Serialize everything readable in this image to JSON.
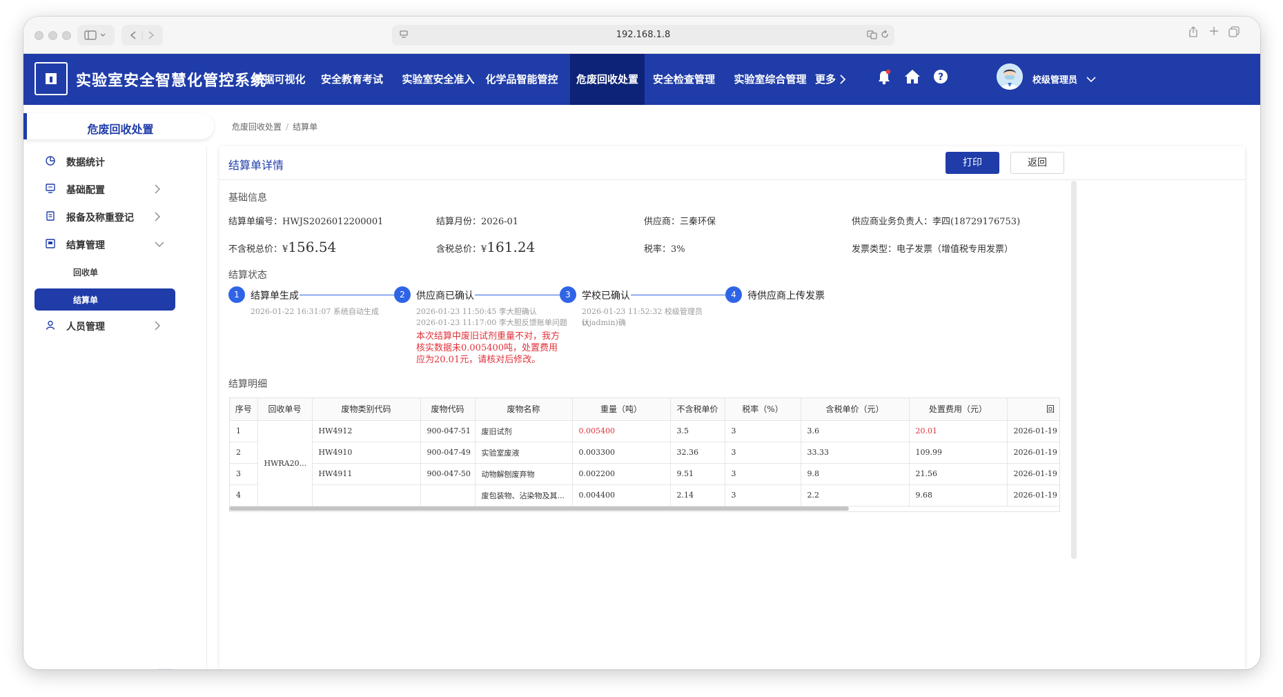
{
  "browser": {
    "url": "192.168.1.8"
  },
  "header": {
    "title": "实验室安全智慧化管控系统",
    "nav": [
      "数据可视化",
      "安全教育考试",
      "实验室安全准入",
      "化学品智能管控",
      "危废回收处置",
      "安全检查管理",
      "实验室综合管理",
      "更多"
    ],
    "user": "校级管理员"
  },
  "sidebar": {
    "title": "危废回收处置",
    "items": [
      {
        "label": "数据统计"
      },
      {
        "label": "基础配置"
      },
      {
        "label": "报备及称重登记"
      },
      {
        "label": "结算管理"
      },
      {
        "label": "回收单"
      },
      {
        "label": "结算单"
      },
      {
        "label": "人员管理"
      }
    ]
  },
  "breadcrumb": {
    "parent": "危废回收处置",
    "sep": "/",
    "current": "结算单"
  },
  "panel": {
    "title": "结算单详情",
    "print": "打印",
    "back": "返回"
  },
  "basic": {
    "section": "基础信息",
    "no_label": "结算单编号：",
    "no": "HWJS2026012200001",
    "month_label": "结算月份：",
    "month": "2026-01",
    "supplier_label": "供应商：",
    "supplier": "三秦环保",
    "contact_label": "供应商业务负责人：",
    "contact": "李四(18729176753)",
    "pretax_label": "不含税总价：",
    "currency": "¥",
    "pretax": "156.54",
    "tax_total_label": "含税总价：",
    "tax_total": "161.24",
    "rate_label": "税率：",
    "rate": "3%",
    "invoice_label": "发票类型：",
    "invoice": "电子发票（增值税专用发票）"
  },
  "status": {
    "section": "结算状态",
    "steps": [
      {
        "num": "1",
        "title": "结算单生成",
        "desc": [
          "2026-01-22 16:31:07 系统自动生成"
        ]
      },
      {
        "num": "2",
        "title": "供应商已确认",
        "desc": [
          "2026-01-23 11:50:45 李大胆确认",
          "2026-01-23 11:17:00 李大胆反馈账单问题"
        ],
        "note": "本次结算中废旧试剂重量不对，我方核实数据未0.005400吨，处置费用应为20.01元，请核对后修改。"
      },
      {
        "num": "3",
        "title": "学校已确认",
        "desc": [
          "2026-01-23 11:52:32 校级管理员(xjadmin)确",
          "认"
        ]
      },
      {
        "num": "4",
        "title": "待供应商上传发票",
        "desc": []
      }
    ]
  },
  "detail": {
    "section": "结算明细",
    "columns": [
      "序号",
      "回收单号",
      "废物类别代码",
      "废物代码",
      "废物名称",
      "重量（吨）",
      "不含税单价",
      "税率（%）",
      "含税单价（元）",
      "处置费用（元）",
      "回"
    ],
    "recycle_no": "HWRA20...",
    "rows": [
      {
        "idx": "1",
        "cat": "HW4912",
        "code": "900-047-51",
        "name": "废旧试剂",
        "weight": "0.005400",
        "price": "3.5",
        "rate": "3",
        "tax_price": "3.6",
        "fee": "20.01",
        "date": "2026-01-19"
      },
      {
        "idx": "2",
        "cat": "HW4910",
        "code": "900-047-49",
        "name": "实验室废液",
        "weight": "0.003300",
        "price": "32.36",
        "rate": "3",
        "tax_price": "33.33",
        "fee": "109.99",
        "date": "2026-01-19"
      },
      {
        "idx": "3",
        "cat": "HW4911",
        "code": "900-047-50",
        "name": "动物解刨废弃物",
        "weight": "0.002200",
        "price": "9.51",
        "rate": "3",
        "tax_price": "9.8",
        "fee": "21.56",
        "date": "2026-01-19"
      },
      {
        "idx": "4",
        "cat": "",
        "code": "",
        "name": "废包装物、沾染物及其...",
        "weight": "0.004400",
        "price": "2.14",
        "rate": "3",
        "tax_price": "2.2",
        "fee": "9.68",
        "date": "2026-01-19"
      }
    ]
  },
  "colors": {
    "primary": "#1f3ca8",
    "nav_active": "#0d2377",
    "step": "#2f64e6",
    "danger": "#e0323b"
  }
}
